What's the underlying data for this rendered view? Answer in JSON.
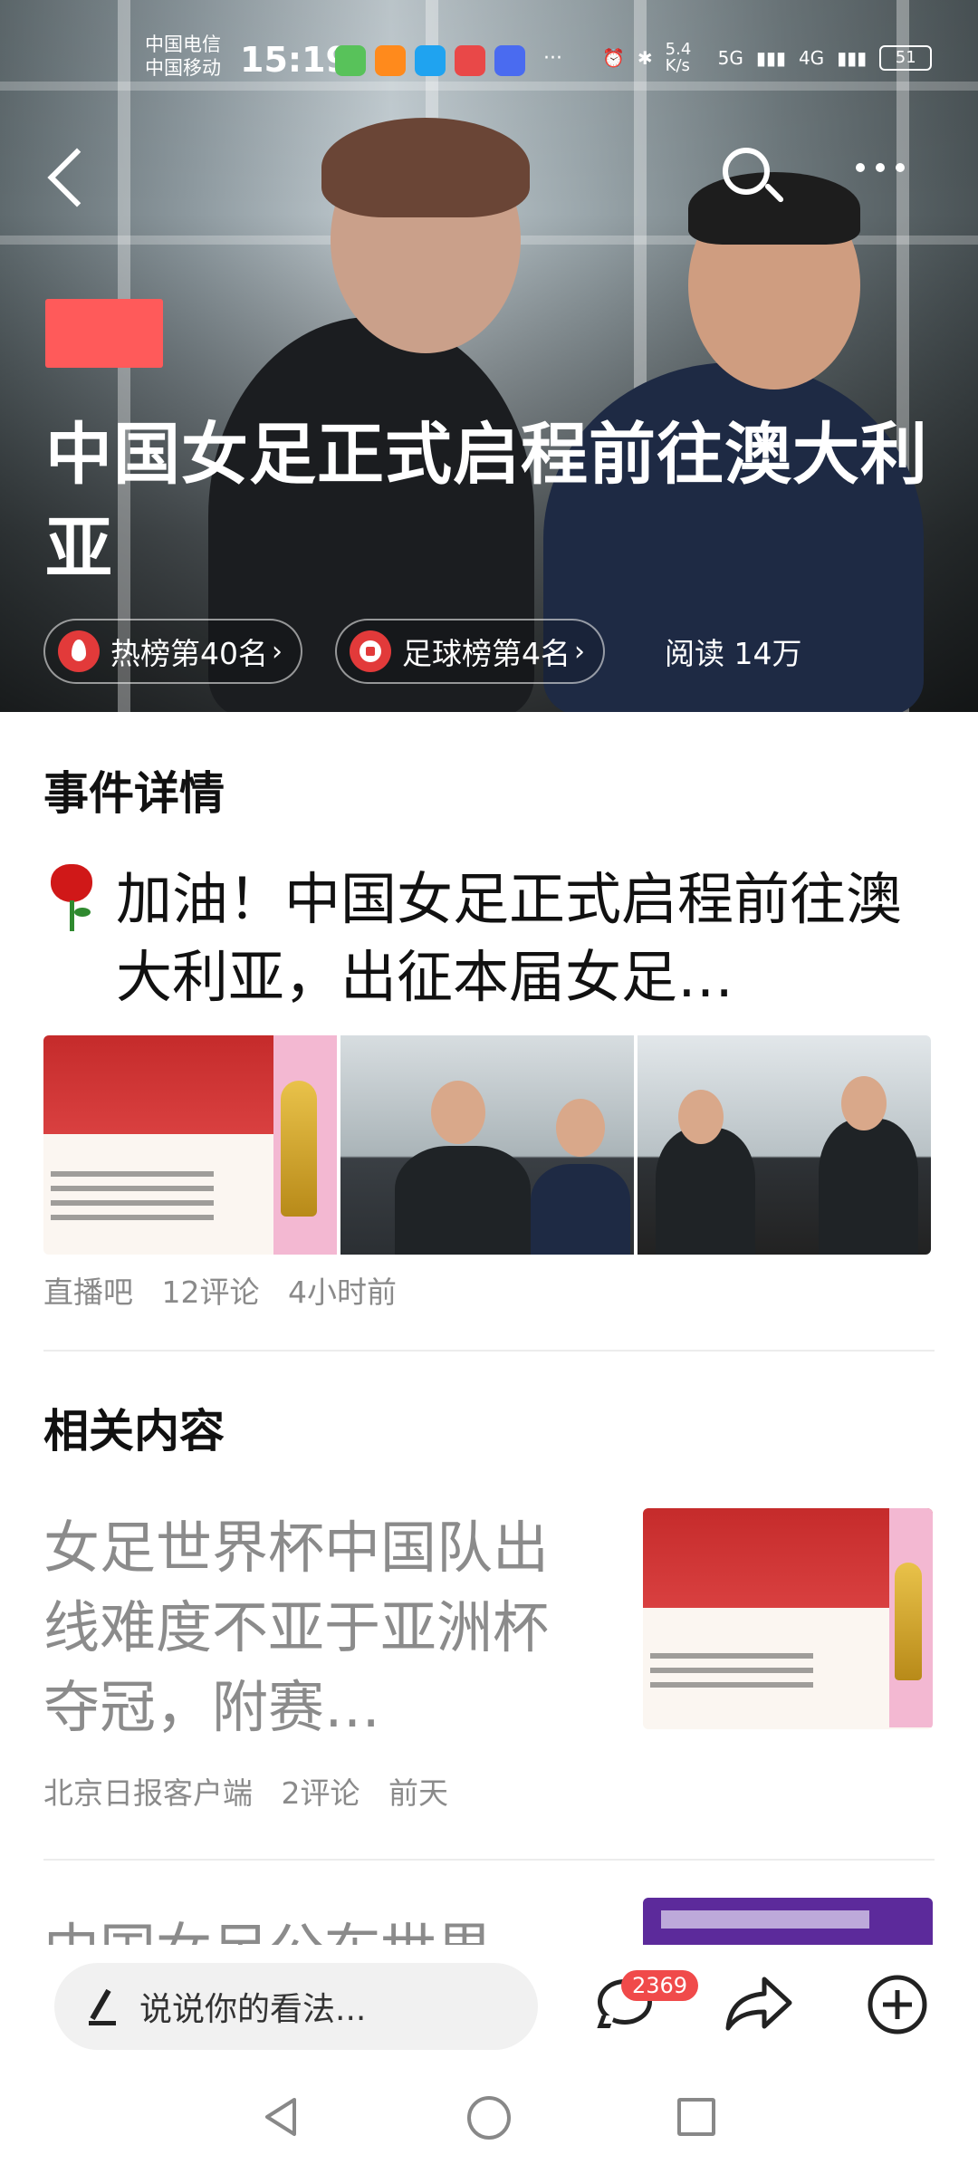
{
  "status_bar": {
    "carrier_1": "中国电信",
    "carrier_2": "中国移动",
    "time": "15:19",
    "more": "···",
    "network_speed": "5.4 K/s",
    "signal_1": "5G",
    "signal_2": "4G",
    "battery": "51"
  },
  "hero": {
    "title": "中国女足正式启程前往澳大利亚",
    "hot_rank": "热榜第40名",
    "football_rank": "足球榜第4名",
    "reads": "阅读 14万",
    "icons": [
      "back-arrow",
      "search",
      "more-dots",
      "flame",
      "soccer-ball"
    ]
  },
  "event_section": {
    "title": "事件详情",
    "headline": "加油！中国女足正式启程前往澳大利亚，出征本届女足…",
    "source": "直播吧",
    "comments": "12评论",
    "time": "4小时前"
  },
  "related_section": {
    "title": "相关内容",
    "items": [
      {
        "title": "女足世界杯中国队出线难度不亚于亚洲杯夺冠，附赛…",
        "source": "北京日报客户端",
        "comments": "2评论",
        "time": "前天"
      },
      {
        "title": "中国女足公布世界"
      }
    ]
  },
  "bottom_bar": {
    "comment_placeholder": "说说你的看法...",
    "comment_count": "2369"
  },
  "colors": {
    "accent_red": "#f04a4a",
    "rank_icon_red": "#e23a3a",
    "meta_gray": "#8a8a8a"
  }
}
